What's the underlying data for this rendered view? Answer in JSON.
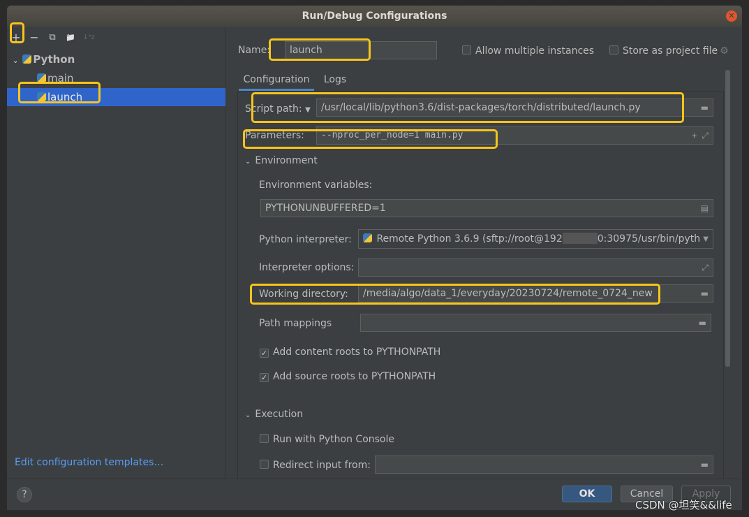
{
  "window": {
    "title": "Run/Debug Configurations"
  },
  "toolbar": {
    "add": "+",
    "remove": "−",
    "copy": "⧉",
    "folder": "📁",
    "sort": "↓ᵃz"
  },
  "tree": {
    "group": "Python",
    "items": [
      {
        "label": "main"
      },
      {
        "label": "launch",
        "selected": true
      }
    ]
  },
  "edit_templates": "Edit configuration templates…",
  "name": {
    "label": "Name:",
    "value": "launch"
  },
  "options": {
    "allow_multiple": {
      "label": "Allow multiple instances",
      "checked": false
    },
    "store_project": {
      "label": "Store as project file",
      "checked": false
    }
  },
  "tabs": [
    {
      "label": "Configuration",
      "active": true
    },
    {
      "label": "Logs"
    }
  ],
  "script": {
    "label": "Script path:",
    "value": "/usr/local/lib/python3.6/dist-packages/torch/distributed/launch.py"
  },
  "parameters": {
    "label": "Parameters:",
    "value": "--nproc_per_node=1 main.py"
  },
  "environment": {
    "header": "Environment",
    "env_label": "Environment variables:",
    "env_value": "PYTHONUNBUFFERED=1",
    "interp_label": "Python interpreter:",
    "interp_value": "Remote Python 3.6.9 (sftp://root@192",
    "interp_value_end": "0:30975/usr/bin/pyth",
    "interp_opts_label": "Interpreter options:",
    "interp_opts_value": "",
    "workdir_label": "Working directory:",
    "workdir_value": "/media/algo/data_1/everyday/20230724/remote_0724_new",
    "pathmap_label": "Path mappings",
    "pathmap_value": "",
    "content_roots": {
      "label": "Add content roots to PYTHONPATH",
      "checked": true
    },
    "source_roots": {
      "label": "Add source roots to PYTHONPATH",
      "checked": true
    }
  },
  "execution": {
    "header": "Execution",
    "console": {
      "label": "Run with Python Console",
      "checked": false
    },
    "redirect": {
      "label": "Redirect input from:",
      "checked": false,
      "value": ""
    }
  },
  "buttons": {
    "help": "?",
    "ok": "OK",
    "cancel": "Cancel",
    "apply": "Apply"
  },
  "watermark": "CSDN @坦笑&&life",
  "colors": {
    "accent": "#2f65ca",
    "highlight": "#f7c51b",
    "ok": "#365880"
  }
}
